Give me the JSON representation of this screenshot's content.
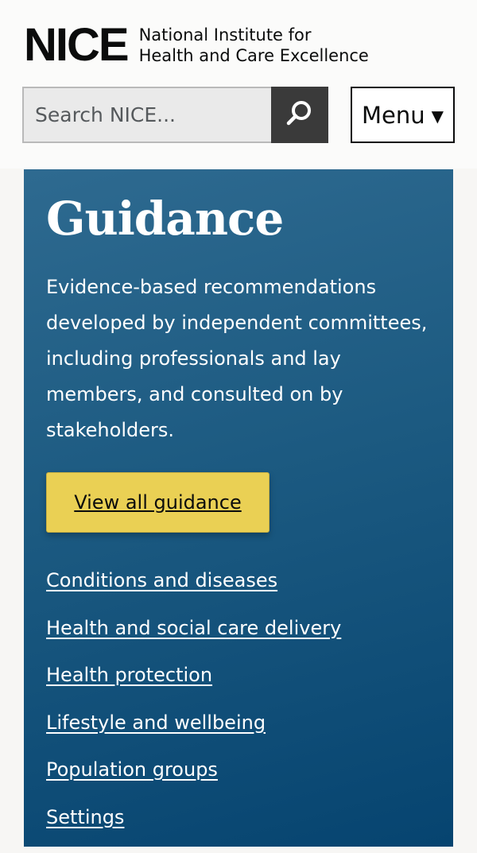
{
  "header": {
    "logo_mark": "NICE",
    "logo_line1": "National Institute for",
    "logo_line2": "Health and Care Excellence"
  },
  "search": {
    "placeholder": "Search NICE...",
    "button_icon": "search-icon"
  },
  "menu": {
    "label": "Menu",
    "caret": "▼"
  },
  "panel": {
    "title": "Guidance",
    "description": "Evidence-based recommendations developed by independent committees, including professionals and lay members, and consulted on by stakeholders.",
    "cta_label": "View all guidance",
    "links": [
      "Conditions and diseases",
      "Health and social care delivery",
      "Health protection",
      "Lifestyle and wellbeing",
      "Population groups",
      "Settings"
    ]
  },
  "colors": {
    "panel_top": "#2e6a90",
    "panel_bottom": "#064470",
    "cta": "#ead054",
    "search_button": "#3a3a3a"
  }
}
